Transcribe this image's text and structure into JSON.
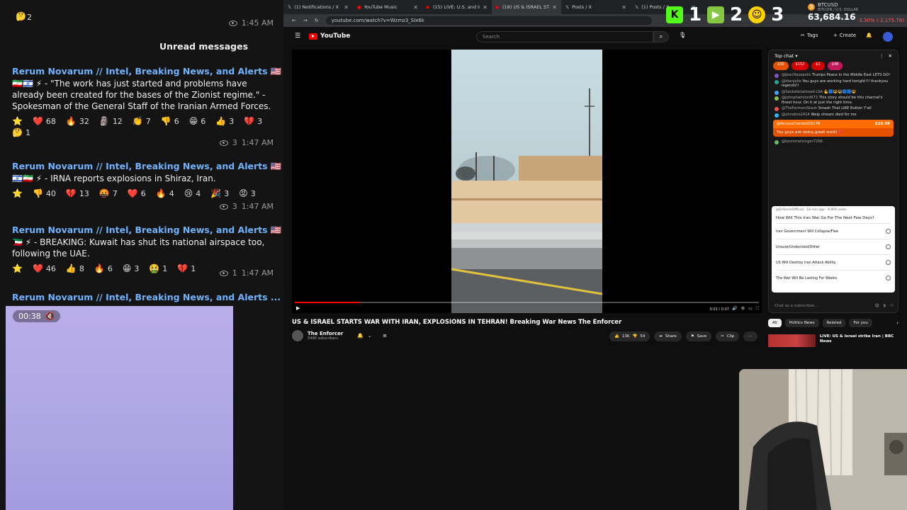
{
  "telegram": {
    "top_row": {
      "count": "2",
      "time": "1:45 AM"
    },
    "unread_label": "Unread messages",
    "messages": [
      {
        "sender": "Rerum Novarum // Intel, Breaking News, and Alerts 🇺🇸",
        "body": "🇮🇷🇮🇱 ⚡ - \"The work has just started and problems have already been created for the bases of the Zionist regime.\" - Spokesman of the General Staff of the Iranian Armed Forces.",
        "reactions": [
          {
            "emoji": "⭐",
            "count": ""
          },
          {
            "emoji": "❤️",
            "count": "68"
          },
          {
            "emoji": "🔥",
            "count": "32"
          },
          {
            "emoji": "🗿",
            "count": "12"
          },
          {
            "emoji": "👏",
            "count": "7"
          },
          {
            "emoji": "👎",
            "count": "6"
          },
          {
            "emoji": "😁",
            "count": "6"
          },
          {
            "emoji": "👍",
            "count": "3"
          },
          {
            "emoji": "💔",
            "count": "3"
          },
          {
            "emoji": "🤔",
            "count": "1"
          }
        ],
        "views": "3",
        "time": "1:47 AM"
      },
      {
        "sender": "Rerum Novarum // Intel, Breaking News, and Alerts 🇺🇸",
        "body": "🇮🇱🇮🇷 ⚡ - IRNA reports explosions in Shiraz, Iran.",
        "reactions": [
          {
            "emoji": "⭐",
            "count": ""
          },
          {
            "emoji": "👎",
            "count": "40"
          },
          {
            "emoji": "💔",
            "count": "13"
          },
          {
            "emoji": "🤬",
            "count": "7"
          },
          {
            "emoji": "❤️",
            "count": "6"
          },
          {
            "emoji": "🔥",
            "count": "4"
          },
          {
            "emoji": "😢",
            "count": "4"
          },
          {
            "emoji": "🎉",
            "count": "3"
          },
          {
            "emoji": "😡",
            "count": "3"
          }
        ],
        "views": "3",
        "time": "1:47 AM"
      },
      {
        "sender": "Rerum Novarum // Intel, Breaking News, and Alerts 🇺🇸",
        "body": "🇰🇼 ⚡ - BREAKING: Kuwait has shut its national airspace too, following the UAE.",
        "reactions": [
          {
            "emoji": "⭐",
            "count": ""
          },
          {
            "emoji": "❤️",
            "count": "46"
          },
          {
            "emoji": "👍",
            "count": "8"
          },
          {
            "emoji": "🔥",
            "count": "6"
          },
          {
            "emoji": "😁",
            "count": "3"
          },
          {
            "emoji": "🤮",
            "count": "1"
          },
          {
            "emoji": "💔",
            "count": "1"
          }
        ],
        "views": "1",
        "time": "1:47 AM"
      }
    ],
    "last_sender": "Rerum Novarum // Intel, Breaking News, and Alerts ...",
    "video_duration": "00:38"
  },
  "browser": {
    "tabs": [
      {
        "label": "(1) Notifications / X"
      },
      {
        "label": "YouTube Music"
      },
      {
        "label": "(15) LIVE: U.S. and Israel la"
      },
      {
        "label": "(18) US & ISRAEL STAR",
        "active": true
      },
      {
        "label": "Posts / X"
      },
      {
        "label": "(1) Posts / X"
      }
    ],
    "url": "youtube.com/watch?v=Wzmz3_SIx6k"
  },
  "overlay": {
    "items": [
      {
        "icon": "kick-logo-icon",
        "color": "#53fc18",
        "value": "1"
      },
      {
        "icon": "rumble-logo-icon",
        "color": "#85c742",
        "value": "2"
      },
      {
        "icon": "twitch-logo-icon",
        "color": "#ffd200",
        "value": "3"
      }
    ],
    "ticker": {
      "symbol": "BTCUSD",
      "subtitle": "BITCOIN / U.S. DOLLAR",
      "price": "63,684.16",
      "change": "-3.30% (-2,175.78)"
    }
  },
  "youtube": {
    "logo_text": "YouTube",
    "search_placeholder": "Search",
    "header_buttons": {
      "tags": "Tags",
      "create": "Create"
    },
    "video": {
      "title": "US & ISRAEL STARTS WAR WITH IRAN, EXPLOSIONS IN TEHRAN! Breaking War News The Enforcer",
      "time": "0:01 / 0:07",
      "progress": 0.14
    },
    "channel": {
      "name": "The Enforcer",
      "subscribers": "549K subscribers"
    },
    "actions": {
      "likes": "13K",
      "dislikes": "54",
      "share": "Share",
      "save": "Save",
      "clip": "Clip"
    },
    "chat": {
      "header": "Top chat",
      "pins": [
        "$30",
        "$152",
        "$1",
        "$48"
      ],
      "lines": [
        {
          "user": "@JeanHasapolis",
          "text": "Trumps Peace in the Middle East LETS GO!",
          "color": "#7e57c2"
        },
        {
          "user": "@btenjalie",
          "text": "You guys are working hard tonight!!! thankyou legends!!",
          "color": "#26a69a"
        },
        {
          "user": "@Santefeirailroad-LSA",
          "text": "💪🟦🔱🔱🟦🟦🔱",
          "color": "#42a5f5"
        },
        {
          "user": "@johnphamlord973",
          "text": "This story should be this channel's finest hour. On it at just the right time.",
          "color": "#8bc34a"
        },
        {
          "user": "@TheFarmersStash",
          "text": "Smash That LIKE Button Y'all",
          "color": "#ef5350"
        },
        {
          "user": "@ohnobro2414",
          "text": "Welp stream died for me",
          "color": "#29b6f6"
        }
      ],
      "superchat": {
        "user": "@AccessDenied20276",
        "amount": "$19.99",
        "message": "You guys are doing great work! ❤️"
      },
      "next_user": "@kevinmelsinger7266",
      "poll": {
        "by": "@EnforcerOfficial · 18 min ago · 9,909 votes",
        "question": "How Will This Iran War Go For The Next Few Days?",
        "options": [
          "Iran Government Will Collapse/Flee",
          "Unsure/Undecided/Other",
          "US Will Destroy Iran Attack Ability",
          "The War Will Be Lasting For Weeks"
        ]
      },
      "input_placeholder": "Chat as a subscriber..."
    },
    "rec_tabs": [
      "All",
      "Politics News",
      "Related",
      "For you"
    ],
    "recommendation": {
      "title": "LIVE: US & Israel strike Iran | BBC News"
    }
  }
}
